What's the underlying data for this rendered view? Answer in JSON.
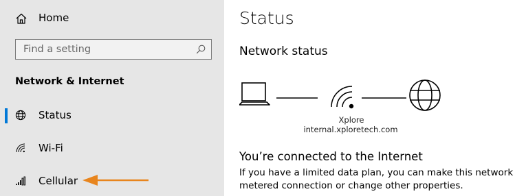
{
  "sidebar": {
    "home": {
      "label": "Home",
      "icon": "home-icon"
    },
    "search": {
      "placeholder": "Find a setting",
      "value": "",
      "icon": "search-icon"
    },
    "section_title": "Network & Internet",
    "items": [
      {
        "label": "Status",
        "icon": "globe-icon",
        "selected": true
      },
      {
        "label": "Wi-Fi",
        "icon": "wifi-icon",
        "selected": false
      },
      {
        "label": "Cellular",
        "icon": "cellular-icon",
        "selected": false
      }
    ]
  },
  "main": {
    "title": "Status",
    "subtitle": "Network status",
    "diagram": {
      "network_name": "Xplore",
      "network_domain": "internal.xploretech.com",
      "icons": [
        "laptop-icon",
        "wifi-icon",
        "globe-icon"
      ]
    },
    "connected_heading": "You’re connected to the Internet",
    "info_line_1": "If you have a limited data plan, you can make this network a",
    "info_line_2": "metered connection or change other properties."
  },
  "annotation": {
    "arrow_color": "#e8851e",
    "points_to": "Cellular"
  },
  "colors": {
    "sidebar_bg": "#e6e6e6",
    "main_bg": "#ffffff",
    "accent": "#0078d7",
    "arrow": "#e8851e"
  }
}
